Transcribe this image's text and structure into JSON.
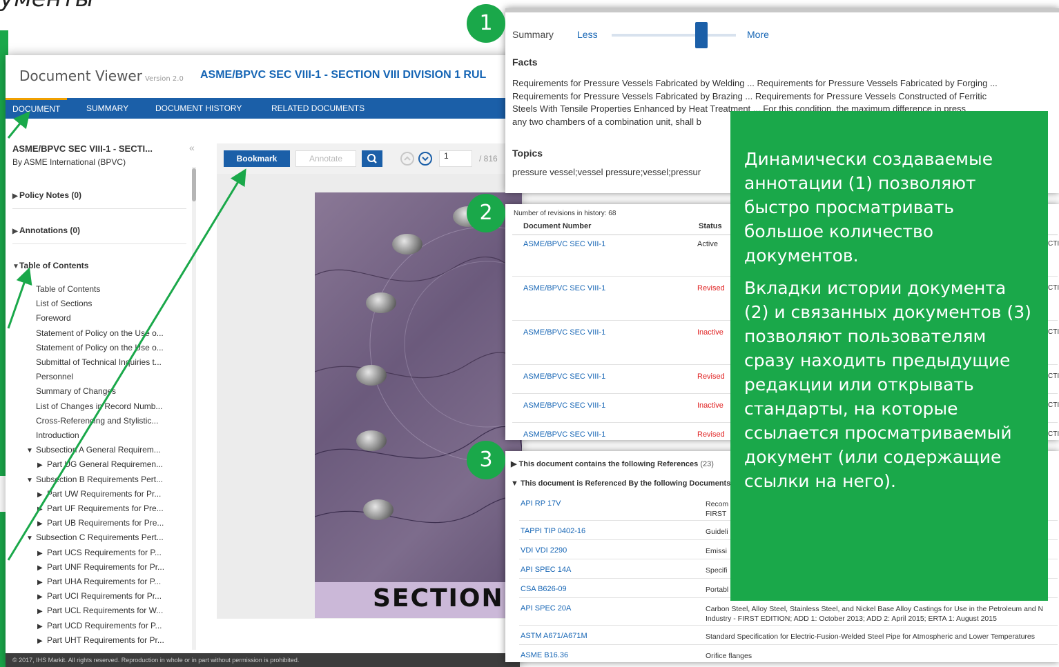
{
  "slide": {
    "title": "ументы"
  },
  "viewer": {
    "app_name": "Document Viewer",
    "version": "Version 2.0",
    "doc_title": "ASME/BPVC SEC VIII-1 - SECTION VIII DIVISION 1 RUL",
    "tabs": [
      "DOCUMENT",
      "SUMMARY",
      "DOCUMENT HISTORY",
      "RELATED DOCUMENTS"
    ],
    "sidebar": {
      "title": "ASME/BPVC SEC VIII-1 - SECTI...",
      "publisher": "By ASME International (BPVC)",
      "collapse_icon": "«",
      "sections": [
        "Policy Notes (0)",
        "Annotations (0)",
        "Table of Contents"
      ],
      "toc": [
        "Table of Contents",
        "List of Sections",
        "Foreword",
        "Statement of Policy on the Use o...",
        "Statement of Policy on the Use o...",
        "Submittal of Technical Inquiries t...",
        "Personnel",
        "Summary of Changes",
        "List of Changes in Record Numb...",
        "Cross-Referencing and Stylistic...",
        "Introduction",
        "Subsection A General Requirem...",
        "Part UG General Requiremen...",
        "Subsection B Requirements Pert...",
        "Part UW Requirements for Pr...",
        "Part UF Requirements for Pre...",
        "Part UB Requirements for Pre...",
        "Subsection C Requirements Pert...",
        "Part UCS Requirements for P...",
        "Part UNF Requirements for Pr...",
        "Part UHA Requirements for P...",
        "Part UCI Requirements for Pr...",
        "Part UCL Requirements for W...",
        "Part UCD Requirements for P...",
        "Part UHT Requirements for Pr..."
      ]
    },
    "toolbar": {
      "bookmark": "Bookmark",
      "annotate": "Annotate",
      "page": "1",
      "total": "/ 816"
    },
    "cover_text": "SECTION",
    "footer": "© 2017, IHS Markit. All rights reserved. Reproduction in whole or in part without permission is prohibited."
  },
  "panel1": {
    "summary_label": "Summary",
    "less": "Less",
    "more": "More",
    "slider_level": 0.72,
    "facts_heading": "Facts",
    "facts_text": "Requirements for Pressure Vessels Fabricated by Welding ... Requirements for Pressure Vessels Fabricated by Forging ... Requirements for Pressure Vessels Fabricated by Brazing ... Requirements for Pressure Vessels Constructed of Ferritic Steels With Tensile Properties Enhanced by Heat Treatment ... For this condition, the maximum difference in press",
    "facts_tail": "any two chambers of a combination unit, shall b",
    "topics_heading": "Topics",
    "topics_text": "pressure vessel;vessel pressure;vessel;pressur"
  },
  "panel2": {
    "count": "Number of revisions in history: 68",
    "col_doc": "Document Number",
    "col_status": "Status",
    "rows": [
      {
        "doc": "ASME/BPVC SEC VIII-1",
        "status": "Active",
        "clip": "CTI"
      },
      {
        "doc": "ASME/BPVC SEC VIII-1",
        "status": "Revised",
        "clip": "CTI"
      },
      {
        "doc": "ASME/BPVC SEC VIII-1",
        "status": "Inactive",
        "clip": "CTI"
      },
      {
        "doc": "ASME/BPVC SEC VIII-1",
        "status": "Revised",
        "clip": "CTI"
      },
      {
        "doc": "ASME/BPVC SEC VIII-1",
        "status": "Inactive",
        "clip": "CTI"
      },
      {
        "doc": "ASME/BPVC SEC VIII-1",
        "status": "Revised",
        "clip": "CTI"
      }
    ]
  },
  "panel3": {
    "contains_label": "This document contains the following References",
    "contains_count": "(23)",
    "referenced_label": "This document is Referenced By the following Documents",
    "rows": [
      {
        "code": "API RP 17V",
        "desc": "Recom",
        "desc2": "FIRST"
      },
      {
        "code": "TAPPI TIP 0402-16",
        "desc": "Guideli"
      },
      {
        "code": "VDI VDI 2290",
        "desc": "Emissi"
      },
      {
        "code": "API SPEC 14A",
        "desc": "Specifi"
      },
      {
        "code": "CSA B626-09",
        "desc": "Portabl"
      },
      {
        "code": "API SPEC 20A",
        "desc": "Carbon Steel, Alloy Steel, Stainless Steel, and Nickel Base Alloy Castings for Use in the Petroleum and N",
        "desc2": "Industry - FIRST EDITION; ADD 1: October 2013; ADD 2: April 2015; ERTA 1: August 2015"
      },
      {
        "code": "ASTM A671/A671M",
        "desc": "Standard Specification for Electric-Fusion-Welded Steel Pipe for Atmospheric and Lower Temperatures"
      },
      {
        "code": "ASME B16.36",
        "desc": "Orifice flanges"
      }
    ]
  },
  "callout": {
    "para1": "Динамически создаваемые аннотации (1) позволяют быстро просматривать большое количество документов.",
    "para2": "Вкладки истории документа (2) и связанных документов (3) позволяют пользователям сразу находить предыдущие редакции или открывать стандарты, на которые ссылается просматриваемый документ (или содержащие ссылки на него)."
  },
  "badges": [
    "1",
    "2",
    "3"
  ],
  "colors": {
    "accent_green": "#1aa84a",
    "viewer_blue": "#1b5fa8",
    "link_blue": "#1464b4",
    "status_active": "#333333",
    "status_red": "#e02020"
  }
}
